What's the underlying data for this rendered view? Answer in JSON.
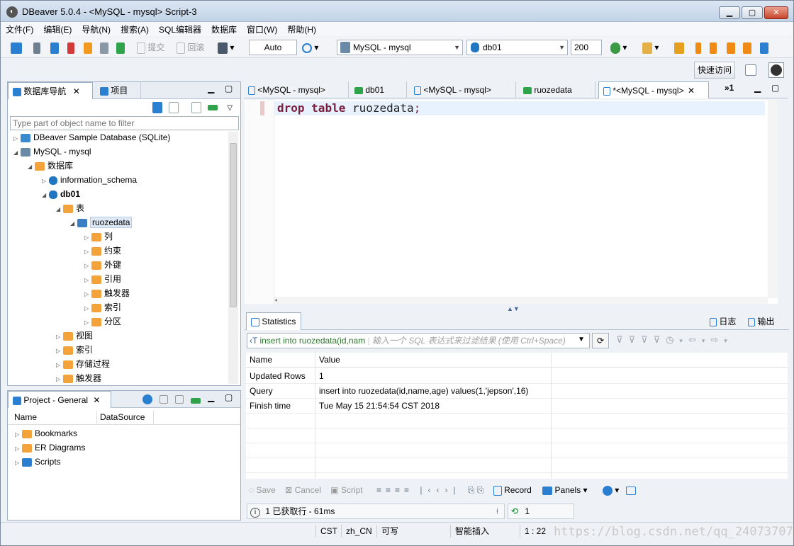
{
  "window": {
    "title": "DBeaver 5.0.4 - <MySQL - mysql> Script-3"
  },
  "menu": [
    "文件(F)",
    "编辑(E)",
    "导航(N)",
    "搜索(A)",
    "SQL编辑器",
    "数据库",
    "窗口(W)",
    "帮助(H)"
  ],
  "toolbar": {
    "commit_label": "提交",
    "rollback_label": "回滚",
    "tx_mode": "Auto",
    "datasource": "MySQL - mysql",
    "schema": "db01",
    "fetch_size": "200",
    "quick_access": "快速访问"
  },
  "navigator": {
    "tab_label": "数据库导航",
    "tab2_label": "项目",
    "filter_placeholder": "Type part of object name to filter",
    "tree": {
      "sample_db": "DBeaver Sample Database (SQLite)",
      "mysql": "MySQL - mysql",
      "databases": "数据库",
      "info_schema": "information_schema",
      "db01": "db01",
      "tables": "表",
      "ruozedata": "ruozedata",
      "columns": "列",
      "constraints": "约束",
      "foreign_keys": "外键",
      "references": "引用",
      "triggers": "触发器",
      "indexes": "索引",
      "partitions": "分区",
      "views": "视图",
      "indexes2": "索引",
      "procedures": "存储过程",
      "triggers2": "触发器"
    }
  },
  "project": {
    "tab_label": "Project - General",
    "col_name": "Name",
    "col_datasource": "DataSource",
    "items": [
      "Bookmarks",
      "ER Diagrams",
      "Scripts"
    ]
  },
  "editor_tabs": [
    "<MySQL - mysql>",
    "db01",
    "<MySQL - mysql>",
    "ruozedata",
    "*<MySQL - mysql>"
  ],
  "editor_overflow": "»1",
  "editor": {
    "kw1": "drop",
    "kw2": "table",
    "ident": "ruozedata",
    "punct": ";"
  },
  "results": {
    "tab_label": "Statistics",
    "log_label": "日志",
    "output_label": "输出",
    "query_filter": "insert into ruozedata(id,nam",
    "filter_placeholder": "输入一个 SQL 表达式来过滤结果 (使用 Ctrl+Space)",
    "col_name": "Name",
    "col_value": "Value",
    "rows": [
      {
        "name": "Updated Rows",
        "value": "1"
      },
      {
        "name": "Query",
        "value": "insert into ruozedata(id,name,age) values(1,'jepson',16)"
      },
      {
        "name": "Finish time",
        "value": "Tue May 15 21:54:54 CST 2018"
      }
    ],
    "buttons": {
      "save": "Save",
      "cancel": "Cancel",
      "script": "Script",
      "record": "Record",
      "panels": "Panels"
    },
    "status": "1 已获取行 - 61ms",
    "count": "1"
  },
  "statusbar": {
    "tz": "CST",
    "locale": "zh_CN",
    "mode": "可写",
    "insert": "智能插入",
    "position": "1 : 22"
  },
  "watermark": "https://blog.csdn.net/qq_24073707"
}
